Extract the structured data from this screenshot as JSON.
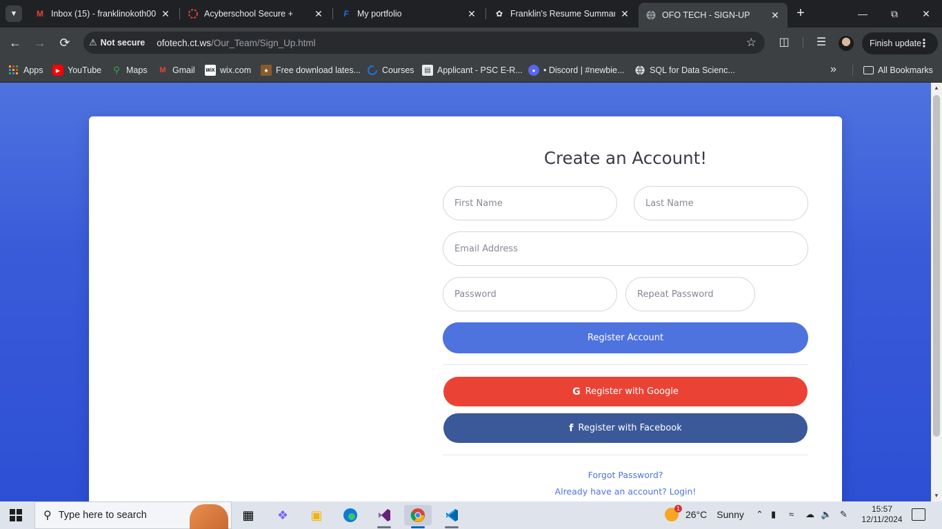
{
  "tabs": [
    {
      "title": "Inbox (15) - franklinokoth00...",
      "icon": "gmail-icon"
    },
    {
      "title": "Acyberschool Secure +",
      "icon": "loading-icon"
    },
    {
      "title": "My portfolio",
      "icon": "portfolio-icon"
    },
    {
      "title": "Franklin's Resume Summary",
      "icon": "chatgpt-icon"
    },
    {
      "title": "OFO TECH - SIGN-UP",
      "icon": "globe-icon"
    }
  ],
  "toolbar": {
    "security_label": "Not secure",
    "url_host": "ofotech.ct.ws",
    "url_path": "/Our_Team/Sign_Up.html",
    "finish_update_label": "Finish update"
  },
  "bookmarks": [
    {
      "label": "Apps",
      "icon": "apps-grid-icon",
      "color": "#f4b400"
    },
    {
      "label": "YouTube",
      "icon": "youtube-icon",
      "color": "#ff0000"
    },
    {
      "label": "Maps",
      "icon": "maps-icon",
      "color": "#34a853"
    },
    {
      "label": "Gmail",
      "icon": "gmail-icon",
      "color": "#ea4335"
    },
    {
      "label": "wix.com",
      "icon": "wix-icon",
      "color": "#ffffff"
    },
    {
      "label": "Free download lates...",
      "icon": "download-site-icon",
      "color": "#a0522d"
    },
    {
      "label": "Courses",
      "icon": "courses-icon",
      "color": "#1a73e8"
    },
    {
      "label": "Applicant - PSC E-R...",
      "icon": "document-icon",
      "color": "#e8eaed"
    },
    {
      "label": "• Discord | #newbie...",
      "icon": "discord-icon",
      "color": "#5865f2"
    },
    {
      "label": "SQL for Data Scienc...",
      "icon": "globe-icon",
      "color": "#e8eaed"
    }
  ],
  "all_bookmarks_label": "All Bookmarks",
  "signup": {
    "title": "Create an Account!",
    "first_name_placeholder": "First Name",
    "last_name_placeholder": "Last Name",
    "email_placeholder": "Email Address",
    "password_placeholder": "Password",
    "repeat_password_placeholder": "Repeat Password",
    "register_label": "Register Account",
    "google_label": "Register with Google",
    "facebook_label": "Register with Facebook",
    "forgot_password_label": "Forgot Password?",
    "login_label": "Already have an account? Login!"
  },
  "colors": {
    "primary": "#4e73df",
    "google": "#ea4335",
    "facebook": "#3b5998"
  },
  "taskbar": {
    "search_placeholder": "Type here to search",
    "apps": [
      "task-view-icon",
      "copilot-icon",
      "file-explorer-icon",
      "edge-icon",
      "visual-studio-icon",
      "chrome-icon",
      "vscode-icon"
    ],
    "weather_temp": "26°C",
    "weather_condition": "Sunny",
    "weather_badge": "1",
    "time": "15:57",
    "date": "12/11/2024"
  }
}
